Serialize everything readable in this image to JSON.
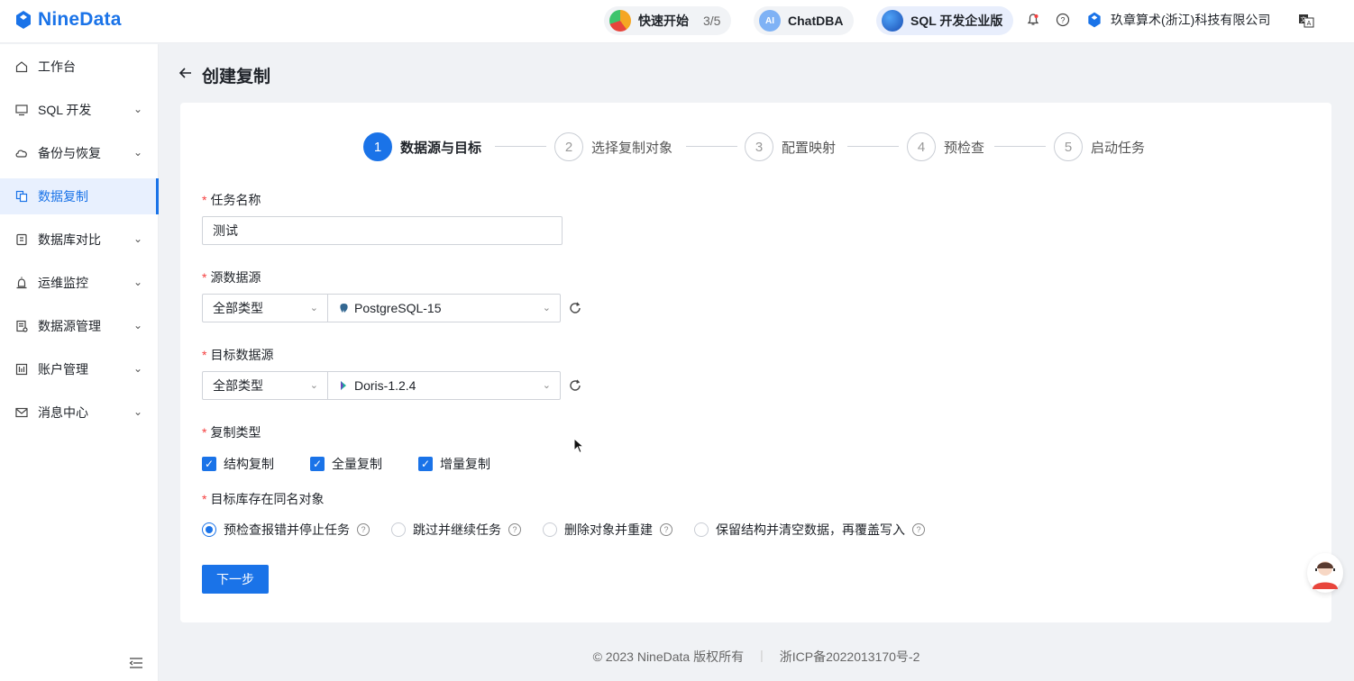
{
  "app": {
    "name": "NineData"
  },
  "topbar": {
    "quick_start": {
      "label": "快速开始",
      "progress": "3/5"
    },
    "chatdba": {
      "label": "ChatDBA",
      "icon_text": "AI"
    },
    "edition": {
      "label": "SQL 开发企业版"
    },
    "company": "玖章算术(浙江)科技有限公司"
  },
  "sidebar": {
    "items": [
      {
        "label": "工作台",
        "icon": "home-icon",
        "chevron": false
      },
      {
        "label": "SQL 开发",
        "icon": "monitor-icon",
        "chevron": true
      },
      {
        "label": "备份与恢复",
        "icon": "cloud-icon",
        "chevron": true
      },
      {
        "label": "数据复制",
        "icon": "copy-icon",
        "chevron": false,
        "active": true
      },
      {
        "label": "数据库对比",
        "icon": "compare-icon",
        "chevron": true
      },
      {
        "label": "运维监控",
        "icon": "alarm-icon",
        "chevron": true
      },
      {
        "label": "数据源管理",
        "icon": "datasource-icon",
        "chevron": true
      },
      {
        "label": "账户管理",
        "icon": "account-icon",
        "chevron": true
      },
      {
        "label": "消息中心",
        "icon": "mail-icon",
        "chevron": true
      }
    ]
  },
  "page": {
    "title": "创建复制"
  },
  "steps": [
    {
      "num": "1",
      "label": "数据源与目标",
      "active": true
    },
    {
      "num": "2",
      "label": "选择复制对象"
    },
    {
      "num": "3",
      "label": "配置映射"
    },
    {
      "num": "4",
      "label": "预检查"
    },
    {
      "num": "5",
      "label": "启动任务"
    }
  ],
  "form": {
    "task_name": {
      "label": "任务名称",
      "value": "测试"
    },
    "source": {
      "label": "源数据源",
      "type": "全部类型",
      "db": "PostgreSQL-15"
    },
    "target": {
      "label": "目标数据源",
      "type": "全部类型",
      "db": "Doris-1.2.4"
    },
    "copy_type": {
      "label": "复制类型",
      "options": [
        "结构复制",
        "全量复制",
        "增量复制"
      ]
    },
    "conflict": {
      "label": "目标库存在同名对象",
      "options": [
        "预检查报错并停止任务",
        "跳过并继续任务",
        "删除对象并重建",
        "保留结构并清空数据，再覆盖写入"
      ],
      "selected": 0
    },
    "next_label": "下一步"
  },
  "footer": {
    "copyright": "© 2023 NineData 版权所有",
    "icp": "浙ICP备2022013170号-2"
  },
  "colors": {
    "accent": "#1a73e8",
    "required": "#f53f3f"
  }
}
